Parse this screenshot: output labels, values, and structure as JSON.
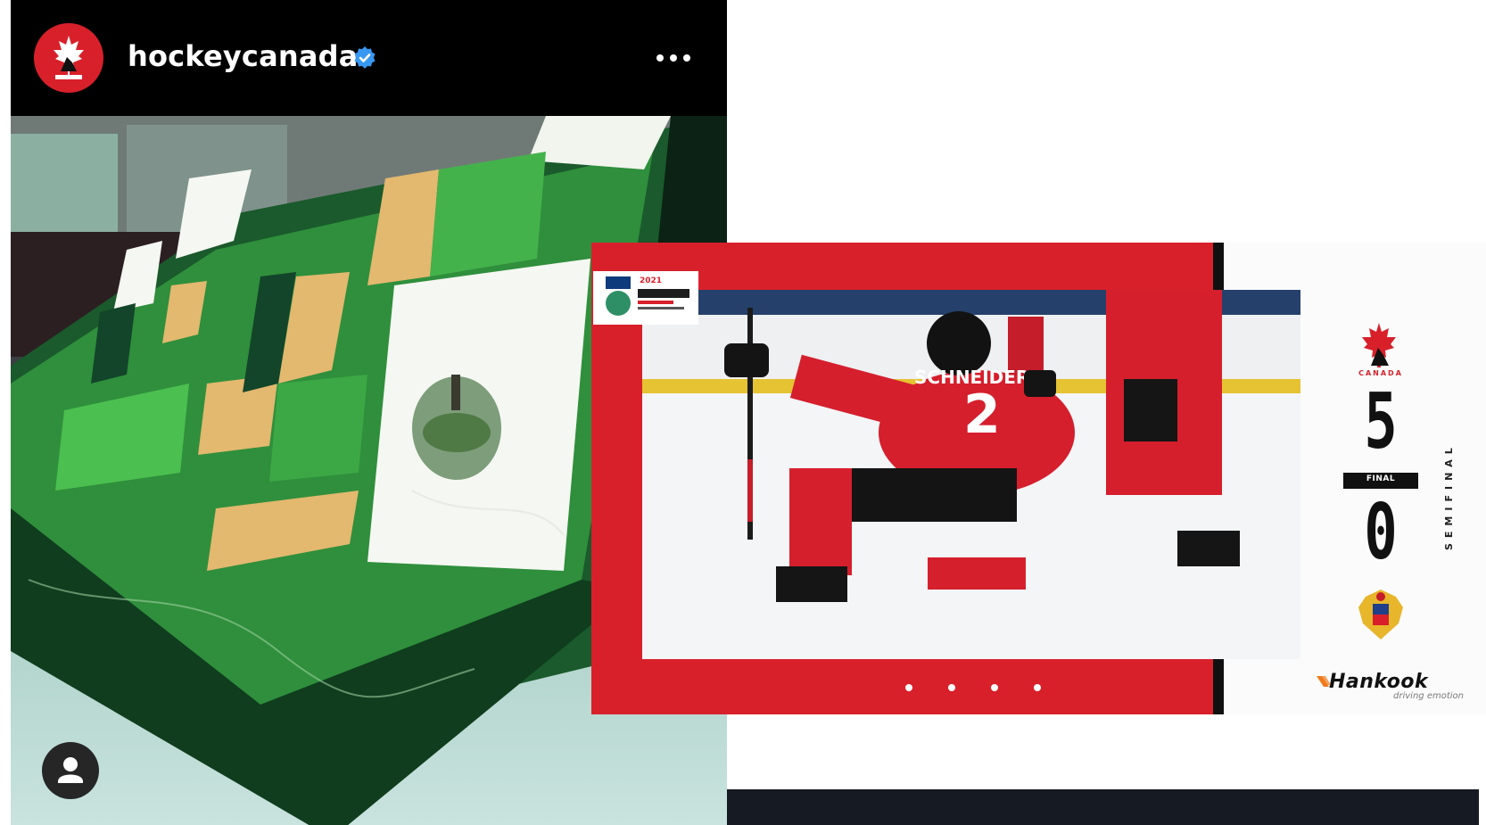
{
  "instagram_post": {
    "username": "hockeycanada",
    "verified_icon": "verified-badge-icon",
    "more_icon": "more-horizontal-icon",
    "user_tag_icon": "person-icon",
    "avatar_icon": "hockey-canada-logo",
    "colors": {
      "brand_red": "#d8202b",
      "verified_blue": "#3897f0"
    }
  },
  "game_result": {
    "event_badge_year": "2021",
    "home_score": "5",
    "away_score": "0",
    "status": "FINAL",
    "round": "SEMIFINAL",
    "home_team_word": "CANADA",
    "sponsor_name": "Hankook",
    "sponsor_tagline": "driving emotion",
    "carousel_dots": 4,
    "player_name": "SCHNEIDER",
    "player_number": "2"
  }
}
